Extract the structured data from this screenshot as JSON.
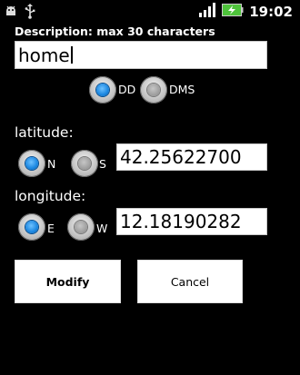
{
  "status_bar": {
    "left_icons": [
      "android-debug-icon",
      "usb-icon"
    ],
    "right_icons": [
      "signal-icon",
      "battery-charging-icon"
    ],
    "time": "19:02"
  },
  "form": {
    "description_label": "Description: max 30 characters",
    "description_value": "home",
    "format_options": [
      {
        "label": "DD",
        "selected": true
      },
      {
        "label": "DMS",
        "selected": false
      }
    ],
    "latitude": {
      "label": "latitude:",
      "options": [
        {
          "label": "N",
          "selected": true
        },
        {
          "label": "S",
          "selected": false
        }
      ],
      "value": "42.25622700"
    },
    "longitude": {
      "label": "longitude:",
      "options": [
        {
          "label": "E",
          "selected": true
        },
        {
          "label": "W",
          "selected": false
        }
      ],
      "value": "12.18190282"
    }
  },
  "buttons": {
    "modify": "Modify",
    "cancel": "Cancel"
  },
  "colors": {
    "background": "#000000",
    "radio_selected": "#1a86e0",
    "battery_green": "#4ec33b"
  }
}
